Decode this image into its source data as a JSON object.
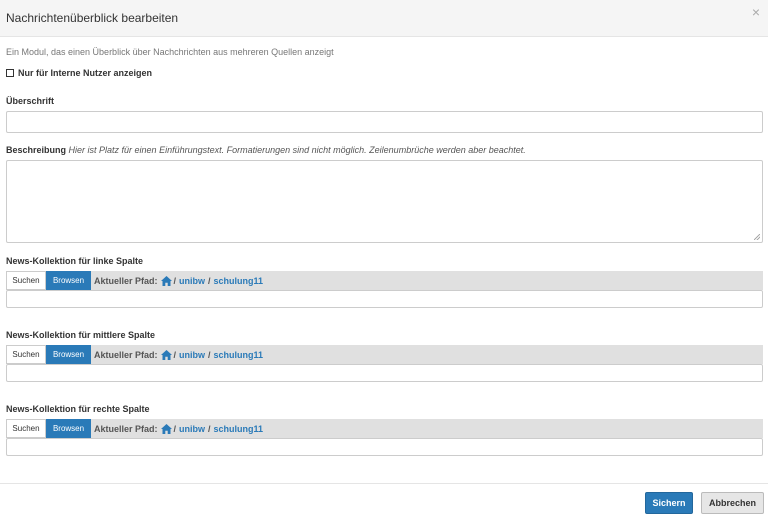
{
  "dialog": {
    "title": "Nachrichtenüberblick bearbeiten",
    "close_icon": "×",
    "intro": "Ein Modul, das einen Überblick über Nachchrichten aus mehreren Quellen anzeigt"
  },
  "internal_only": {
    "label": "Nur für Interne Nutzer anzeigen",
    "checked": false
  },
  "heading_field": {
    "label": "Überschrift",
    "value": ""
  },
  "description_field": {
    "label": "Beschreibung",
    "hint": "Hier ist Platz für einen Einführungstext. Formatierungen sind nicht möglich. Zeilenumbrüche werden aber beachtet.",
    "value": ""
  },
  "collections": [
    {
      "label": "News-Kollektion für linke Spalte",
      "search_label": "Suchen",
      "browse_label": "Browsen",
      "path_label": "Aktueller Pfad:",
      "path": [
        "unibw",
        "schulung11"
      ],
      "value": ""
    },
    {
      "label": "News-Kollektion für mittlere Spalte",
      "search_label": "Suchen",
      "browse_label": "Browsen",
      "path_label": "Aktueller Pfad:",
      "path": [
        "unibw",
        "schulung11"
      ],
      "value": ""
    },
    {
      "label": "News-Kollektion für rechte Spalte",
      "search_label": "Suchen",
      "browse_label": "Browsen",
      "path_label": "Aktueller Pfad:",
      "path": [
        "unibw",
        "schulung11"
      ],
      "value": ""
    }
  ],
  "footer": {
    "save_label": "Sichern",
    "cancel_label": "Abbrechen"
  },
  "colors": {
    "primary": "#2a7ab8",
    "toolbar_bg": "#e0e0e0",
    "header_bg": "#f5f5f5"
  }
}
